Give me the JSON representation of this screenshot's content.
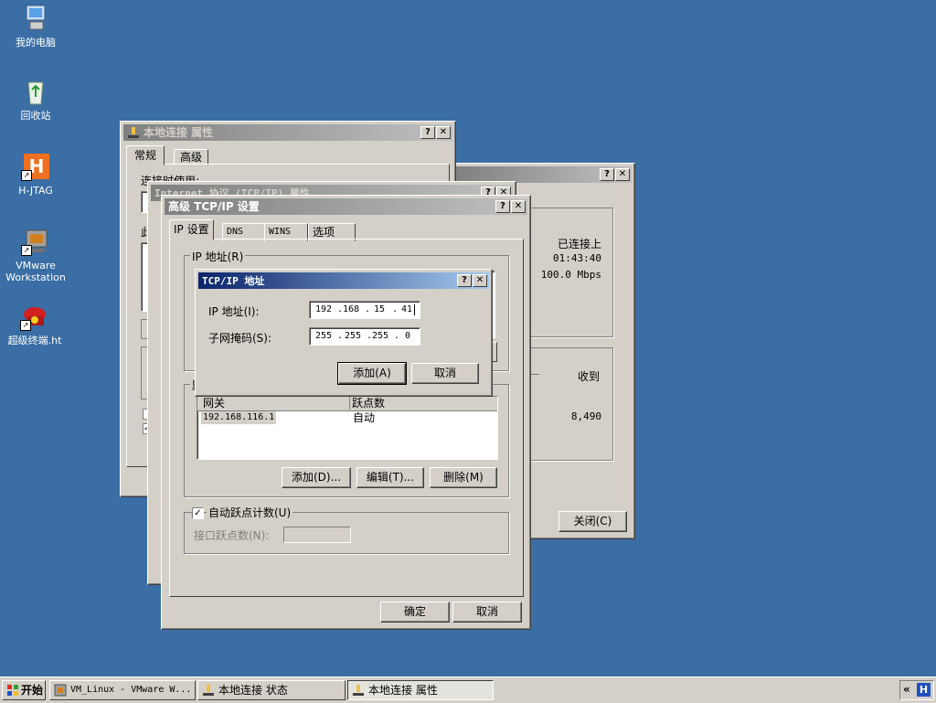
{
  "desktop": {
    "icons": [
      {
        "label": "我的电脑",
        "icon": "my-computer-icon"
      },
      {
        "label": "回收站",
        "icon": "recycle-bin-icon"
      },
      {
        "label": "H-JTAG",
        "icon": "h-jtag-icon"
      },
      {
        "label": "VMware Workstation",
        "icon": "vmware-icon"
      },
      {
        "label": "超级终端.ht",
        "icon": "hyperterminal-icon"
      }
    ]
  },
  "props_window": {
    "title": "本地连接 属性",
    "tabs": [
      "常规",
      "高级"
    ],
    "connect_using": "连接时使用:",
    "frag_this": "此"
  },
  "status_window": {
    "connected": "已连接上",
    "duration": "01:43:40",
    "speed": "100.0 Mbps",
    "received_label": "收到",
    "received_value": "8,490",
    "close_label": "关闭(C)"
  },
  "tcpip_window": {
    "title": "Internet 协议 (TCP/IP) 属性"
  },
  "advanced_window": {
    "title": "高级 TCP/IP 设置",
    "tabs": [
      "IP 设置",
      "DNS",
      "WINS",
      "选项"
    ],
    "ip_group_label": "IP 地址(R)",
    "gateway_group_label": "默",
    "gateway_headers": [
      "网关",
      "跃点数"
    ],
    "gateway_rows": [
      {
        "gateway": "192.168.116.1",
        "metric": "自动"
      }
    ],
    "add_btn": "添加(D)...",
    "edit_btn": "编辑(T)...",
    "delete_btn": "删除(M)",
    "auto_metric": "自动跃点计数(U)",
    "interface_metric": "接口跃点数(N):",
    "ok": "确定",
    "cancel": "取消"
  },
  "addr_dialog": {
    "title": "TCP/IP 地址",
    "ip_label": "IP 地址(I):",
    "ip_octets": [
      "192",
      "168",
      "15",
      "41"
    ],
    "mask_label": "子网掩码(S):",
    "mask_octets": [
      "255",
      "255",
      "255",
      "0"
    ],
    "add": "添加(A)",
    "cancel": "取消"
  },
  "taskbar": {
    "start": "开始",
    "items": [
      "VM_Linux - VMware W...",
      "本地连接 状态",
      "本地连接 属性"
    ],
    "chevron": "«"
  }
}
